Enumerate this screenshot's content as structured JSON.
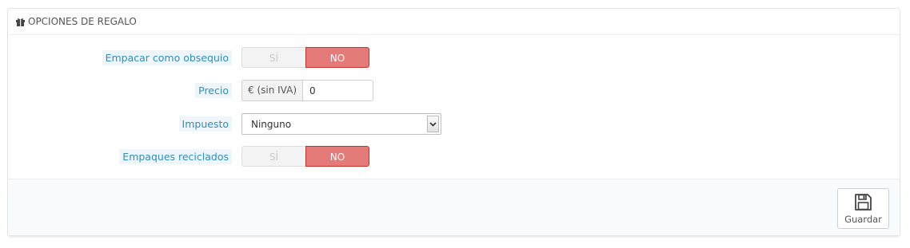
{
  "panel": {
    "title": "OPCIONES DE REGALO",
    "title_icon": "gift-icon"
  },
  "fields": {
    "gift_wrap": {
      "label": "Empacar como obsequio",
      "yes": "SÍ",
      "no": "NO",
      "selected": "NO"
    },
    "price": {
      "label": "Precio",
      "addon": "€ (sin IVA)",
      "value": "0"
    },
    "tax": {
      "label": "Impuesto",
      "selected": "Ninguno"
    },
    "recycled": {
      "label": "Empaques reciclados",
      "yes": "SÍ",
      "no": "NO",
      "selected": "NO"
    }
  },
  "footer": {
    "save_label": "Guardar",
    "save_icon": "floppy-disk-icon"
  },
  "colors": {
    "no_active": "#e47b79",
    "label_text": "#2c8fbe",
    "label_bg": "#eef6fb"
  }
}
